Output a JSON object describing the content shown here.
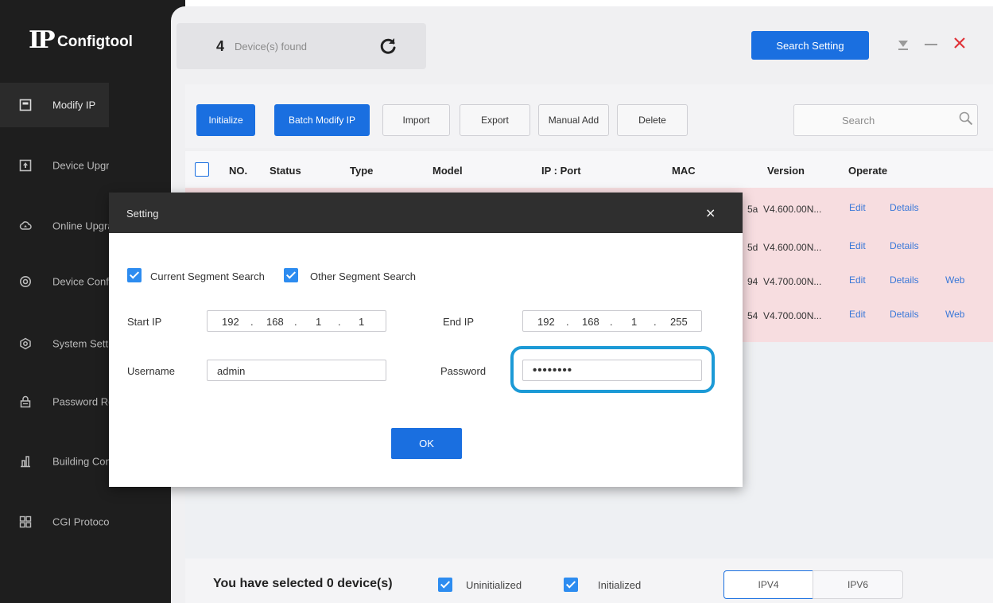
{
  "app": {
    "name": "Configtool",
    "logo_mark": "IP",
    "device_count": "4",
    "device_count_label": "Device(s) found",
    "search_setting_label": "Search Setting"
  },
  "sidebar": {
    "items": [
      {
        "label": "Modify IP",
        "icon": "modify-ip-icon",
        "active": true
      },
      {
        "label": "Device Upgrade",
        "icon": "upgrade-icon"
      },
      {
        "label": "Online Upgrade",
        "icon": "cloud-upgrade-icon"
      },
      {
        "label": "Device Config",
        "icon": "device-config-icon"
      },
      {
        "label": "System Settings",
        "icon": "system-settings-icon"
      },
      {
        "label": "Password Reset",
        "icon": "lock-icon"
      },
      {
        "label": "Building Config",
        "icon": "building-icon"
      },
      {
        "label": "CGI Protocol",
        "icon": "grid-icon"
      }
    ]
  },
  "toolbar": {
    "initialize": "Initialize",
    "batch_modify_ip": "Batch Modify IP",
    "import": "Import",
    "export": "Export",
    "manual_add": "Manual Add",
    "delete": "Delete",
    "search_placeholder": "Search"
  },
  "table": {
    "headers": [
      "NO.",
      "Status",
      "Type",
      "Model",
      "IP : Port",
      "MAC",
      "Version",
      "Operate"
    ],
    "rows": [
      {
        "mac_tail": "5a",
        "version": "V4.600.00N...",
        "edit": "Edit",
        "details": "Details",
        "web": ""
      },
      {
        "mac_tail": "5d",
        "version": "V4.600.00N...",
        "edit": "Edit",
        "details": "Details",
        "web": ""
      },
      {
        "mac_tail": "94",
        "version": "V4.700.00N...",
        "edit": "Edit",
        "details": "Details",
        "web": "Web"
      },
      {
        "mac_tail": "54",
        "version": "V4.700.00N...",
        "edit": "Edit",
        "details": "Details",
        "web": "Web"
      }
    ]
  },
  "footer": {
    "selected_text": "You have selected 0  device(s)",
    "uninitialized": "Uninitialized",
    "initialized": "Initialized",
    "ipv4": "IPV4",
    "ipv6": "IPV6"
  },
  "dialog": {
    "title": "Setting",
    "close": "×",
    "current_segment": "Current Segment Search",
    "other_segment": "Other Segment Search",
    "start_ip_label": "Start IP",
    "start_ip": [
      "192",
      "168",
      "1",
      "1"
    ],
    "end_ip_label": "End IP",
    "end_ip": [
      "192",
      "168",
      "1",
      "255"
    ],
    "ip_dot": ".",
    "username_label": "Username",
    "username_value": "admin",
    "password_label": "Password",
    "password_value": "••••••••",
    "ok": "OK"
  },
  "colors": {
    "accent": "#1a6fe0",
    "highlight_ring": "#1c9ad6",
    "close_x": "#e0343a"
  }
}
